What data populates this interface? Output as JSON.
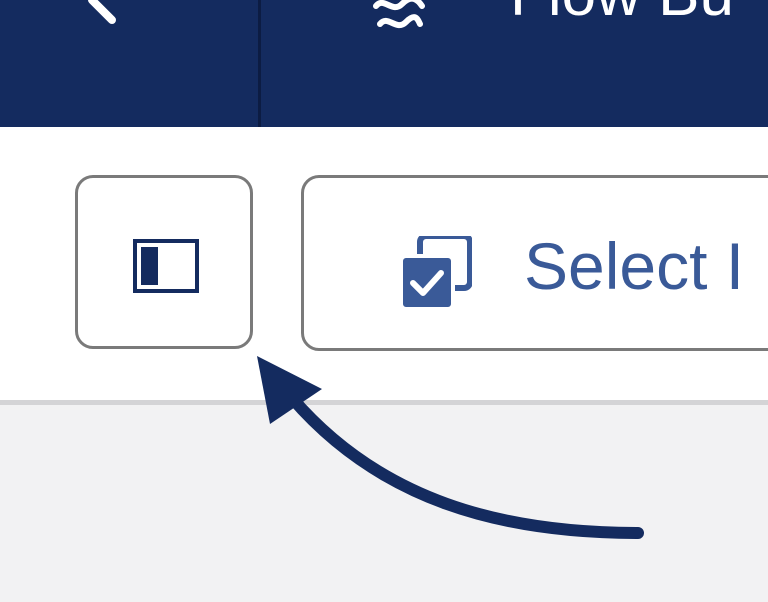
{
  "header": {
    "title": "Flow Bu",
    "back_icon": "chevron-left-icon",
    "logo_icon": "flow-logo-icon"
  },
  "toolbar": {
    "panel_toggle_icon": "sidebar-panel-icon",
    "select_button_label": "Select I",
    "select_button_icon": "multi-select-checkbox-icon"
  },
  "annotation": {
    "arrow_color": "#142b5f"
  },
  "colors": {
    "header_bg": "#142b5f",
    "accent": "#3a5a98",
    "border": "#7a7a7a",
    "canvas_bg": "#f2f2f3"
  }
}
